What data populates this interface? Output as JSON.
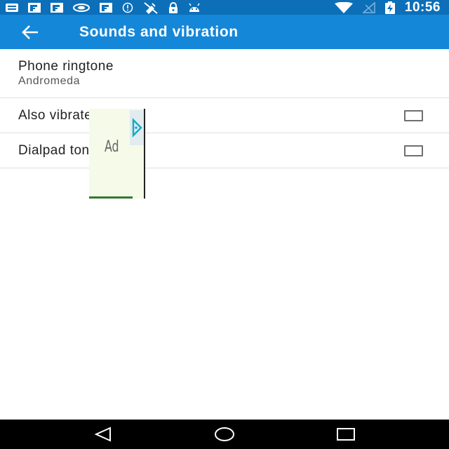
{
  "status_bar": {
    "time": "10:56",
    "left_icons": [
      "message-icon",
      "flipboard-icon",
      "flipboard-icon",
      "signal-icon",
      "flipboard-icon",
      "info-icon",
      "no-satellite-icon",
      "lock-icon",
      "android-icon"
    ],
    "right_icons": [
      "wifi-icon",
      "no-signal-icon",
      "battery-charging-icon"
    ]
  },
  "app_bar": {
    "title": "Sounds and vibration",
    "back_icon": "arrow-back-icon",
    "color": "#1587d8",
    "status_color": "#0c6fb8"
  },
  "settings": {
    "ringtone": {
      "title": "Phone ringtone",
      "value": "Andromeda"
    },
    "vibrate": {
      "title": "Also vibrate for calls",
      "checked": false
    },
    "dialpad": {
      "title": "Dialpad tones",
      "checked": false
    }
  },
  "ad": {
    "label": "Ad",
    "icon": "ad-choices-icon"
  },
  "nav_bar": {
    "icons": [
      "back-triangle-icon",
      "home-circle-icon",
      "recents-square-icon"
    ]
  }
}
